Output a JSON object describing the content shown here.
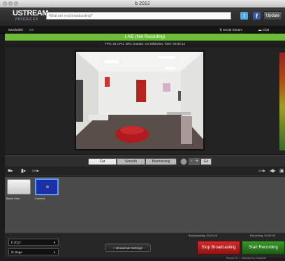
{
  "window": {
    "title": "b 2012"
  },
  "header": {
    "logo_main": "USTREAM",
    "logo_sub": "PRODUCER",
    "search_placeholder": "What are you broadcasting?",
    "twitter_glyph": "t",
    "facebook_glyph": "f",
    "update_label": "Update"
  },
  "subbar": {
    "bandwidth_label": "Bandwidth",
    "bandwidth_value": "IIIII",
    "social_label": "Social Stream",
    "chat_label": "Chat"
  },
  "live": {
    "status": "LIVE (Not Recording)",
    "stats": "FPS: 25   CPU: 39%   Outrate: 2.6 Mbits/sec   Time: 00:00:14"
  },
  "transitions": {
    "cut": "Cut",
    "smooth": "Smooth",
    "boomerang": "Boomerang",
    "minus": "-",
    "plus": "+",
    "go": "Go"
  },
  "shots": [
    {
      "label": "Blank Shot"
    },
    {
      "label": "Camera"
    }
  ],
  "bottom": {
    "broadcasting_time": "Broadcasting: 00:00:15",
    "recording_time": "Recording: 00:00:00",
    "select1_value": "b 2012",
    "select2_value": "ld stage",
    "broadcast_settings": "Broadcast Settings",
    "stop_broadcasting": "Stop Broadcasting",
    "start_recording": "Start Recording",
    "footer": "Record To:  ✓ Ustream   My Computer"
  },
  "colors": {
    "live_green": "#6ebd3a",
    "stop_red": "#c41e1e",
    "start_green": "#2e8a20",
    "camera_blue": "#1a2fa8"
  }
}
